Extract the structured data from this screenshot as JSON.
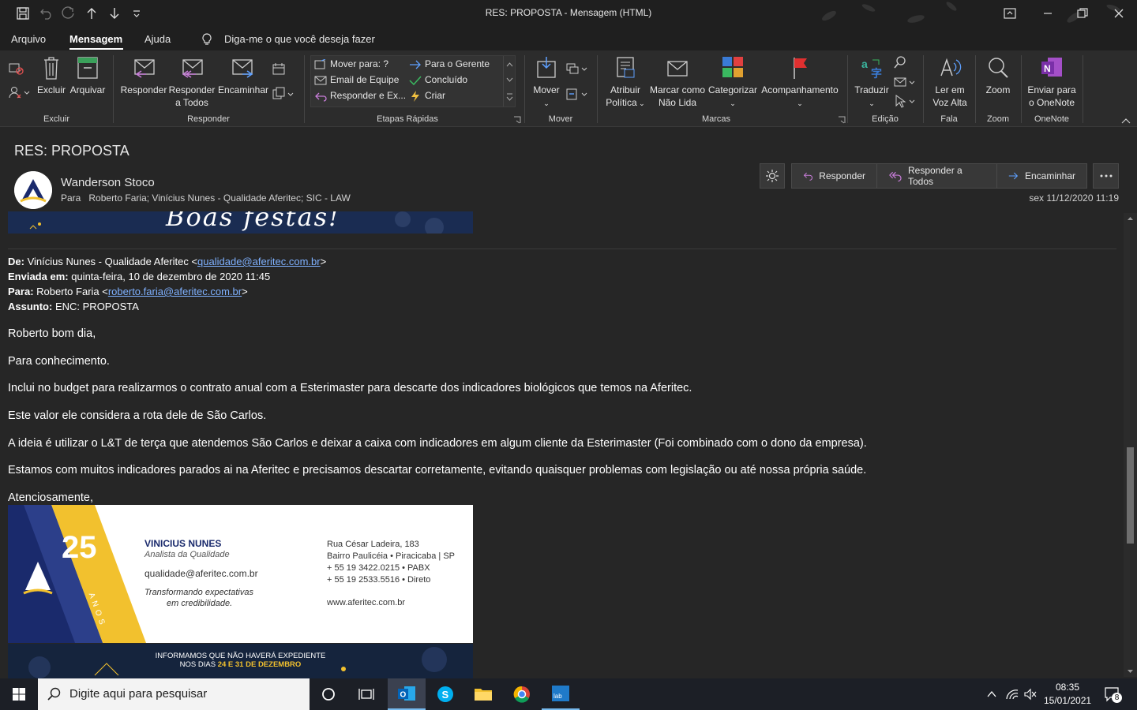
{
  "window": {
    "title": "RES: PROPOSTA  -  Mensagem (HTML)"
  },
  "menu": {
    "tabs": [
      "Arquivo",
      "Mensagem",
      "Ajuda"
    ],
    "tellme": "Diga-me o que você deseja fazer"
  },
  "ribbon": {
    "delete": {
      "excluir": "Excluir",
      "arquivar": "Arquivar",
      "group": "Excluir"
    },
    "respond": {
      "responder": "Responder",
      "responder_todos_1": "Responder",
      "responder_todos_2": "a Todos",
      "encaminhar": "Encaminhar",
      "group": "Responder"
    },
    "quicksteps": {
      "items": [
        "Mover para: ?",
        "Email de Equipe",
        "Responder e Ex...",
        "Para o Gerente",
        "Concluído",
        "Criar"
      ],
      "group": "Etapas Rápidas"
    },
    "move": {
      "mover": "Mover",
      "group": "Mover"
    },
    "tags": {
      "atribuir_1": "Atribuir",
      "atribuir_2": "Política",
      "marcar_1": "Marcar como",
      "marcar_2": "Não Lida",
      "categorizar": "Categorizar",
      "acompanhamento": "Acompanhamento",
      "group": "Marcas"
    },
    "editing": {
      "traduzir": "Traduzir",
      "group": "Edição"
    },
    "speech": {
      "ler_1": "Ler em",
      "ler_2": "Voz Alta",
      "group": "Fala"
    },
    "zoom": {
      "zoom": "Zoom",
      "group": "Zoom"
    },
    "onenote": {
      "enviar_1": "Enviar para",
      "enviar_2": "o OneNote",
      "group": "OneNote"
    }
  },
  "message": {
    "subject": "RES: PROPOSTA",
    "sender": "Wanderson Stoco",
    "to_label": "Para",
    "to": "Roberto Faria; Vinícius Nunes - Qualidade Aferitec; SIC - LAW",
    "date": "sex 11/12/2020 11:19",
    "actions": {
      "responder": "Responder",
      "responder_todos": "Responder a Todos",
      "encaminhar": "Encaminhar"
    },
    "banner_top": "Boas festas!",
    "quoted": {
      "from_label": "De:",
      "from_name": "Vinícius Nunes - Qualidade Aferitec <",
      "from_email": "qualidade@aferitec.com.br",
      "from_close": ">",
      "sent_label": "Enviada em:",
      "sent_value": "quinta-feira, 10 de dezembro de 2020 11:45",
      "to_label": "Para:",
      "to_name": "Roberto Faria <",
      "to_email": "roberto.faria@aferitec.com.br",
      "to_close": ">",
      "subject_label": "Assunto:",
      "subject_value": "ENC: PROPOSTA"
    },
    "body": [
      "Roberto bom dia,",
      "Para conhecimento.",
      "Inclui no budget para realizarmos o contrato anual com a Esterimaster para descarte dos indicadores biológicos que temos na Aferitec.",
      "Este valor ele considera a rota dele de São Carlos.",
      "A ideia é utilizar o L&T de terça que atendemos São Carlos e deixar a caixa com indicadores em algum cliente da Esterimaster (Foi combinado com o dono da empresa).",
      "Estamos com muitos indicadores parados ai na Aferitec e precisamos descartar corretamente, evitando quaisquer problemas com legislação ou até nossa própria saúde.",
      "Atenciosamente,"
    ],
    "signature": {
      "years": "25",
      "anos": "A N O S",
      "name": "VINICIUS NUNES",
      "role": "Analista da Qualidade",
      "email": "qualidade@aferitec.com.br",
      "slogan_1": "Transformando expectativas",
      "slogan_2": "em credibilidade.",
      "addr_1": "Rua César Ladeira, 183",
      "addr_2": "Bairro Paulicéia • Piracicaba | SP",
      "phone_1": "+ 55 19 3422.0215 • PABX",
      "phone_2": "+ 55 19 2533.5516 • Direto",
      "web": "www.aferitec.com.br"
    },
    "banner_bottom_1": "INFORMAMOS QUE NÃO HAVERÁ EXPEDIENTE",
    "banner_bottom_2a": "NOS DIAS ",
    "banner_bottom_2b": "24 E 31 DE DEZEMBRO"
  },
  "taskbar": {
    "search_placeholder": "Digite aqui para pesquisar",
    "time": "08:35",
    "date": "15/01/2021",
    "notif_count": "8"
  }
}
